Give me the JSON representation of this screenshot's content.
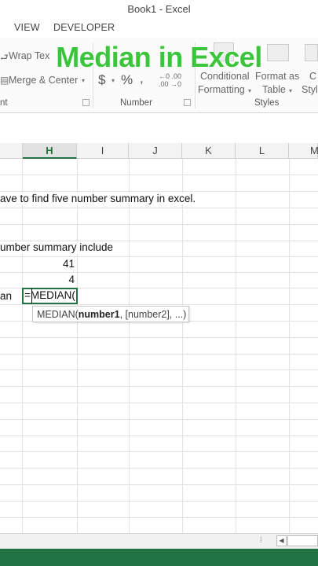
{
  "window": {
    "title": "Book1 - Excel"
  },
  "tabs": [
    "VIEW",
    "DEVELOPER"
  ],
  "ribbon": {
    "wrap_text": "Wrap Tex",
    "merge_center": "Merge & Center",
    "alignment_label_tail": "nt",
    "currency_symbol": "$",
    "percent_symbol": "%",
    "comma_symbol": "͙",
    "inc_decimal": "←0 .00",
    "dec_decimal": ".00 →0",
    "number_label": "Number",
    "conditional": "Conditional",
    "formatting": "Formatting",
    "format_as": "Format as",
    "table": "Table",
    "cell_styles_1": "C",
    "cell_styles_2": "Styl",
    "styles_label": "Styles"
  },
  "overlay": {
    "title": "Median in Excel"
  },
  "columns": [
    "H",
    "I",
    "J",
    "K",
    "L",
    "M"
  ],
  "active_column": "H",
  "cells": {
    "row_text": "ave to find  five number summary in excel.",
    "row_summary": "umber summary include",
    "value_41": "41",
    "value_4": "4",
    "label_an": "an",
    "formula": "=MEDIAN("
  },
  "tooltip": {
    "fn": "MEDIAN(",
    "arg1": "number1",
    "rest": ", [number2], ...)"
  },
  "colors": {
    "accent": "#217346",
    "overlay": "#3cc43c"
  }
}
